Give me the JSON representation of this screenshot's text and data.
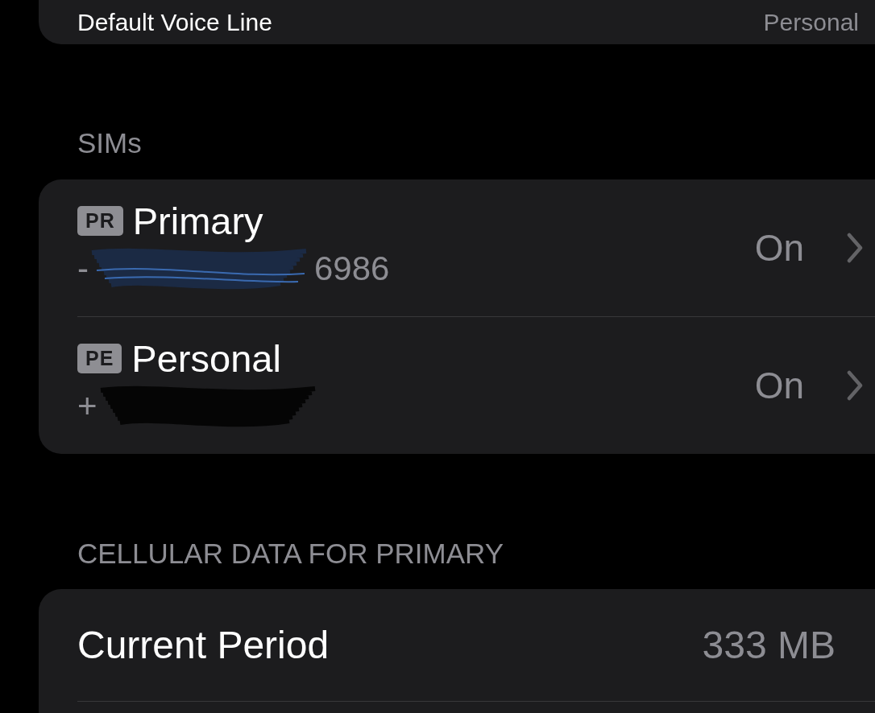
{
  "top_row": {
    "label": "Default Voice Line",
    "value": "Personal"
  },
  "sims_section": {
    "header": "SIMs",
    "rows": [
      {
        "badge": "PR",
        "name": "Primary",
        "number_prefix": "-",
        "number_suffix": "6986",
        "status": "On"
      },
      {
        "badge": "PE",
        "name": "Personal",
        "number_prefix": "+",
        "status": "On"
      }
    ]
  },
  "data_section": {
    "header": "CELLULAR DATA FOR PRIMARY",
    "rows": [
      {
        "label": "Current Period",
        "value": "333 MB"
      }
    ]
  }
}
